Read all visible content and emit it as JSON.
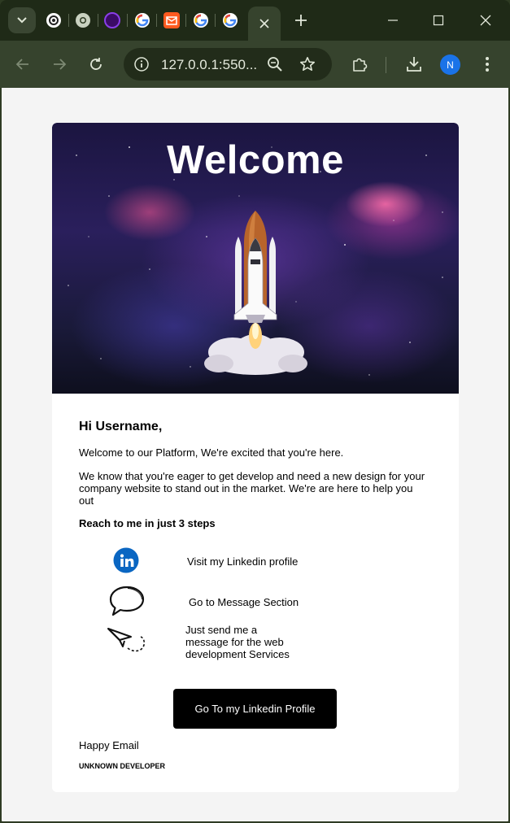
{
  "browser": {
    "url": "127.0.0.1:550...",
    "profile_initial": "N",
    "accent_color": "#1a73e8",
    "tabs": [
      {
        "icon": "openai-icon"
      },
      {
        "icon": "chrome-icon"
      },
      {
        "icon": "purple-circle-icon"
      },
      {
        "icon": "google-icon"
      },
      {
        "icon": "mail-icon"
      },
      {
        "icon": "google-icon"
      },
      {
        "icon": "google-icon"
      }
    ]
  },
  "email": {
    "hero_title": "Welcome",
    "greeting": "Hi Username,",
    "intro": "Welcome to our Platform, We're excited that you're here.",
    "body": "We know that you're eager to get develop and need a new design for your company website to stand out in the market. We're are here to help you out",
    "steps_title": "Reach to me in just 3 steps",
    "steps": [
      {
        "icon": "linkedin-icon",
        "text": "Visit my Linkedin profile"
      },
      {
        "icon": "speech-bubble-icon",
        "text": "Go to Message Section"
      },
      {
        "icon": "paper-plane-icon",
        "text": "Just send me a message for the web development Services"
      }
    ],
    "cta_label": "Go To my Linkedin Profile",
    "signoff": "Happy Email",
    "signature": "UNKNOWN DEVELOPER",
    "colors": {
      "cta_bg": "#000000",
      "linkedin": "#0a66c2"
    }
  }
}
